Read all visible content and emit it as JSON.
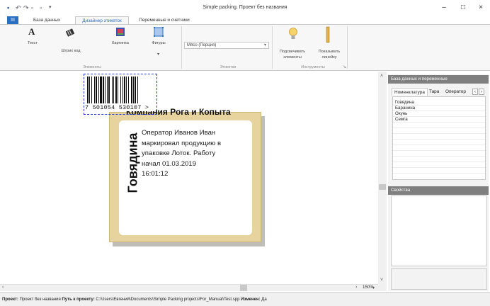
{
  "window": {
    "title": "Simple packing. Проект без названия",
    "controls": [
      "–",
      "□",
      "×"
    ]
  },
  "ribbon": {
    "file_tab": "III",
    "tabs": [
      "База данных",
      "Дизайнер этикеток",
      "Переменные и счетчики"
    ],
    "elements": {
      "text_label": "Текст",
      "text_icon_glyph": "A",
      "barcode_label": "Штрих код",
      "image_label": "Картинка",
      "shapes_label": "Фигуры",
      "group_label": "Элементы"
    },
    "labels": {
      "selected_value": "Мясо (Порция)",
      "group_label": "Этикетки"
    },
    "tools": {
      "highlight_label_1": "Подсвечивать",
      "highlight_label_2": "элементы",
      "ruler_label_1": "Показывать",
      "ruler_label_2": "линейку",
      "group_label": "Инструменты"
    }
  },
  "canvas": {
    "barcode_digits": "7 501054 530107 >",
    "company": "Компания Рога и Копыта",
    "body_lines": [
      "Оператор Иванов Иван",
      "маркировал продукцию в",
      "упаковке Лоток. Работу",
      "начал 01.03.2019",
      "16:01:12"
    ],
    "vertical_text": "Говядина",
    "zoom": "150%"
  },
  "right_panel": {
    "db_header": "База данных и переменные",
    "tabs": [
      "Номенклатура",
      "Тара",
      "Оператор"
    ],
    "items": [
      "Говядина",
      "Баранина",
      "Окунь",
      "Семга"
    ],
    "props_header": "Свойства"
  },
  "status": {
    "project_label": "Проект:",
    "project_value": "Проект без названия",
    "path_label": "Путь к проекту:",
    "path_value": "C:\\Users\\Евгений\\Documents\\Simple Packing projects\\For_Manual\\Test.spp",
    "changed_label": "Изменен:",
    "changed_value": "Да"
  },
  "colors": {
    "accent": "#2b6fc2",
    "label_frame": "#e6d39d",
    "panel_header": "#7f7f7f",
    "selection": "#2d3cd8"
  }
}
